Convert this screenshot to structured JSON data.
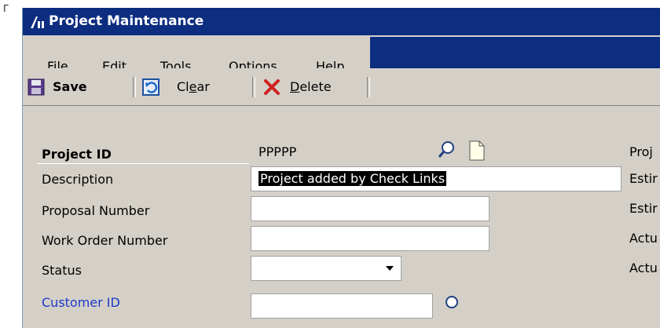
{
  "window": {
    "title": "Project Maintenance"
  },
  "menu": [
    {
      "label": "File"
    },
    {
      "label": "Edit"
    },
    {
      "label": "Tools"
    },
    {
      "label": "Options"
    },
    {
      "label": "Help"
    }
  ],
  "toolbar": {
    "save_label": "Save",
    "clear_label": "Clear",
    "clear_mnemonic": "e",
    "delete_label": "Delete",
    "delete_mnemonic": "D"
  },
  "form": {
    "project_id": {
      "label": "Project ID",
      "value": "PPPPP"
    },
    "description": {
      "label": "Description",
      "value": "Project added by Check Links"
    },
    "proposal_number": {
      "label": "Proposal Number",
      "value": ""
    },
    "work_order_number": {
      "label": "Work Order Number",
      "value": ""
    },
    "status": {
      "label": "Status",
      "value": ""
    },
    "customer_id": {
      "label": "Customer ID",
      "value": ""
    }
  },
  "right_labels": [
    "Proj",
    "Estir",
    "Estir",
    "Actu",
    "Actu"
  ],
  "colors": {
    "title_bar": "#0c2d80",
    "window_bg": "#d4d0c8",
    "link": "#1d38c9"
  }
}
